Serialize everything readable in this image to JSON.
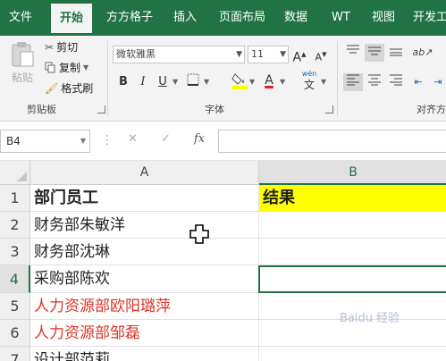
{
  "ribbon_tabs": [
    "文件",
    "开始",
    "方方格子",
    "插入",
    "页面布局",
    "数据",
    "WT",
    "视图",
    "开发工"
  ],
  "active_tab": "开始",
  "clipboard": {
    "paste": "粘贴",
    "cut": "剪切",
    "copy": "复制",
    "format_painter": "格式刷",
    "group_label": "剪贴板"
  },
  "font": {
    "name": "微软雅黑",
    "size": "11",
    "grow": "A",
    "shrink": "A",
    "bold": "B",
    "italic": "I",
    "underline": "U",
    "font_color_glyph": "A",
    "phonetic_top": "wén",
    "phonetic_bottom": "文",
    "group_label": "字体",
    "fill_color": "#ffff00",
    "font_color": "#e02020"
  },
  "alignment": {
    "group_label": "对齐方"
  },
  "formula_bar": {
    "name_box": "B4",
    "cancel": "✕",
    "enter": "✓",
    "fx": "fx",
    "value": ""
  },
  "grid": {
    "columns": [
      "A",
      "B"
    ],
    "rows": [
      {
        "num": "1",
        "a": "部门员工",
        "b": "结果"
      },
      {
        "num": "2",
        "a": "财务部朱敏洋",
        "b": ""
      },
      {
        "num": "3",
        "a": "财务部沈琳",
        "b": ""
      },
      {
        "num": "4",
        "a": "采购部陈欢",
        "b": ""
      },
      {
        "num": "5",
        "a": "人力资源部欧阳璐萍",
        "b": ""
      },
      {
        "num": "6",
        "a": "人力资源部邹磊",
        "b": ""
      },
      {
        "num": "7",
        "a": "设计部范莉",
        "b": ""
      }
    ],
    "header_fill": "#ffff00",
    "selected_cell": "B4",
    "accent": "#217346",
    "red_text": "#d9352a"
  },
  "watermark": "Baidu 经验"
}
